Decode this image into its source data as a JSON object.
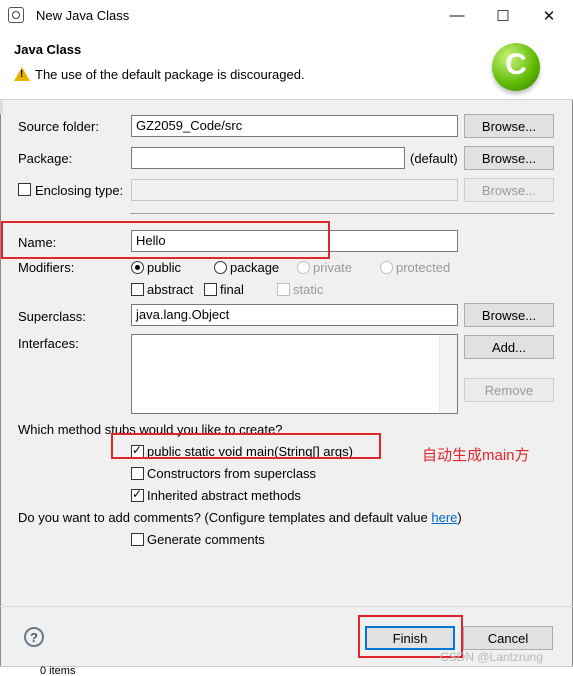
{
  "window": {
    "title": "New Java Class",
    "minimize_glyph": "—",
    "maximize_glyph": "☐",
    "close_glyph": "✕"
  },
  "header": {
    "heading": "Java Class",
    "message": "The use of the default package is discouraged.",
    "logo_letter": "C"
  },
  "form": {
    "source_folder_label": "Source folder:",
    "source_folder_value": "GZ2059_Code/src",
    "browse_label": "Browse...",
    "package_label": "Package:",
    "package_value": "",
    "default_label": "(default)",
    "enclosing_label": "Enclosing type:",
    "name_label": "Name:",
    "name_value": "Hello",
    "modifiers_label": "Modifiers:",
    "modifiers": {
      "public": "public",
      "package": "package",
      "private": "private",
      "protected": "protected",
      "abstract": "abstract",
      "final": "final",
      "static": "static"
    },
    "superclass_label": "Superclass:",
    "superclass_value": "java.lang.Object",
    "interfaces_label": "Interfaces:",
    "add_label": "Add...",
    "remove_label": "Remove",
    "stubs_question": "Which method stubs would you like to create?",
    "stub_main": "public static void main(String[] args)",
    "stub_constructors": "Constructors from superclass",
    "stub_inherited": "Inherited abstract methods",
    "comments_question": "Do you want to add comments? (Configure templates and default value ",
    "comments_link": "here",
    "comments_close": ")",
    "generate_comments": "Generate comments"
  },
  "annotation": {
    "text": "自动生成main方"
  },
  "footer": {
    "help_glyph": "?",
    "finish_label": "Finish",
    "cancel_label": "Cancel"
  },
  "watermark": "CSDN @Lantzrung",
  "background_fragment": "0 items",
  "colors": {
    "annotation_red": "#e0262c",
    "default_button_border": "#0078d7",
    "link": "#0066cc"
  }
}
